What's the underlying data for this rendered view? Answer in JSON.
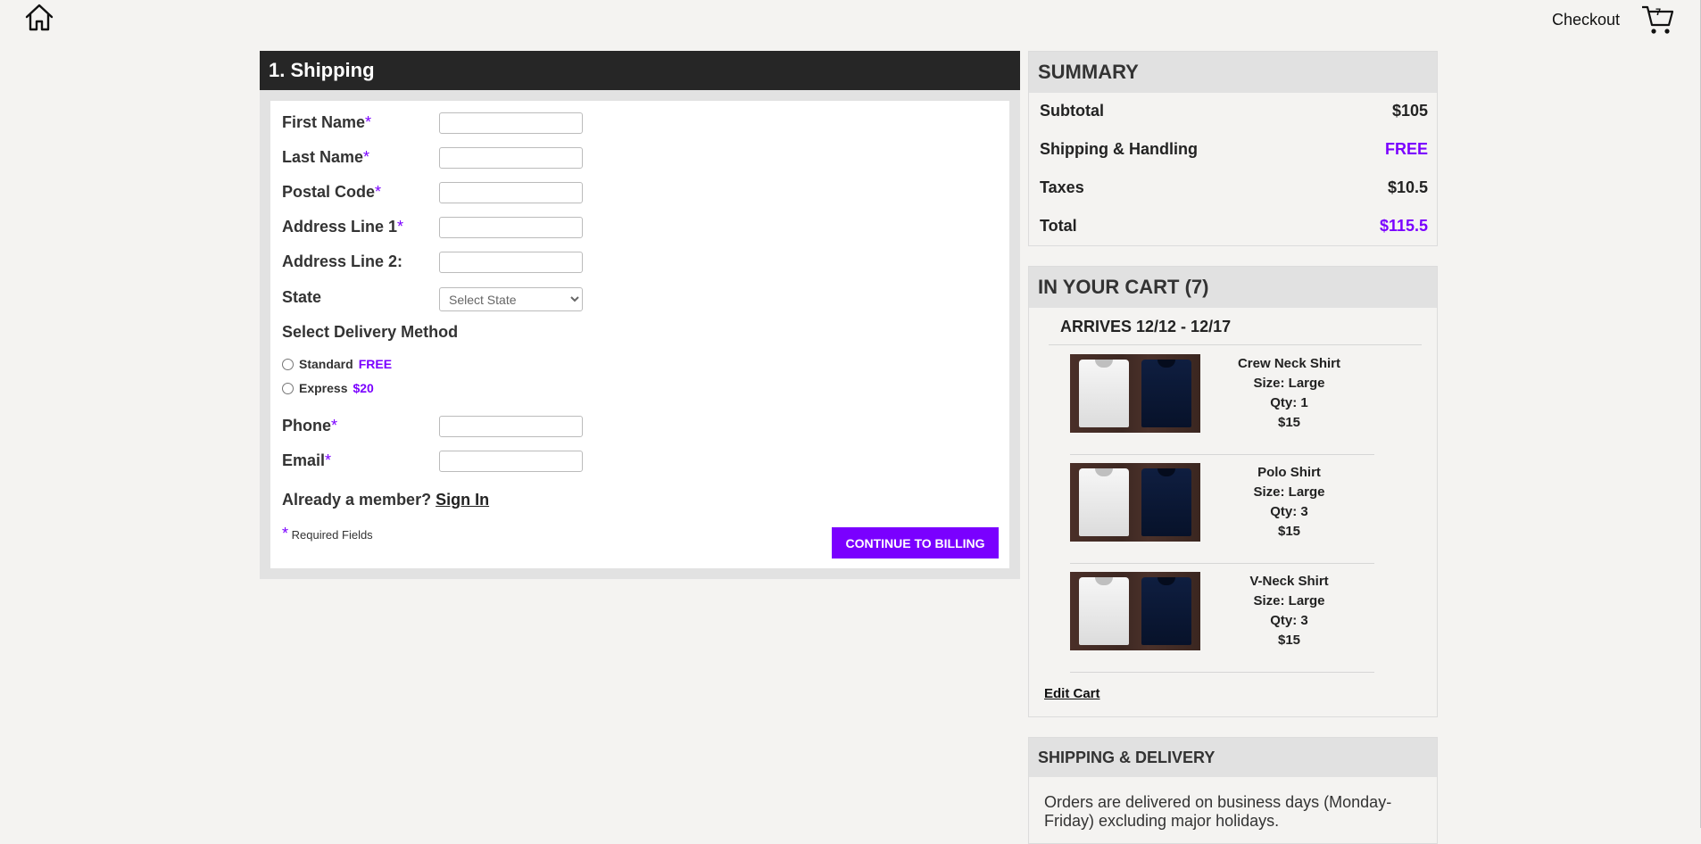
{
  "header": {
    "home_icon": "home-icon",
    "checkout_label": "Checkout",
    "cart_icon": "shopping-cart-icon",
    "cart_count": "7"
  },
  "shipping": {
    "title": "1. Shipping",
    "fields": {
      "first_name": "First Name",
      "last_name": "Last Name",
      "postal_code": "Postal Code",
      "address1": "Address Line 1",
      "address2": "Address Line 2:",
      "state": "State",
      "phone": "Phone",
      "email": "Email"
    },
    "required_mark": "*",
    "state_placeholder": "Select State",
    "delivery_heading": "Select Delivery Method",
    "delivery_options": [
      {
        "label": "Standard",
        "price": "FREE"
      },
      {
        "label": "Express",
        "price": "$20"
      }
    ],
    "member_prompt": "Already a member?",
    "sign_in": "Sign In",
    "required_note": "Required Fields",
    "continue_button": "CONTINUE TO BILLING"
  },
  "summary": {
    "title": "SUMMARY",
    "rows": [
      {
        "label": "Subtotal",
        "value": "$105"
      },
      {
        "label": "Shipping & Handling",
        "value": "FREE"
      },
      {
        "label": "Taxes",
        "value": "$10.5"
      },
      {
        "label": "Total",
        "value": "$115.5"
      }
    ]
  },
  "cart": {
    "title": "IN YOUR CART (7)",
    "arrives": "ARRIVES 12/12 - 12/17",
    "items": [
      {
        "name": "Crew Neck Shirt",
        "size": "Size: Large",
        "qty": "Qty: 1",
        "price": "$15"
      },
      {
        "name": "Polo Shirt",
        "size": "Size: Large",
        "qty": "Qty: 3",
        "price": "$15"
      },
      {
        "name": "V-Neck Shirt",
        "size": "Size: Large",
        "qty": "Qty: 3",
        "price": "$15"
      }
    ],
    "edit_cart": "Edit Cart"
  },
  "delivery": {
    "title": "SHIPPING & DELIVERY",
    "text": "Orders are delivered on business days (Monday-Friday) excluding major holidays."
  },
  "colors": {
    "accent": "#7a00ff",
    "header_dark": "#262626",
    "panel_gray": "#e1e1e1",
    "page_bg": "#f4f3f1"
  }
}
